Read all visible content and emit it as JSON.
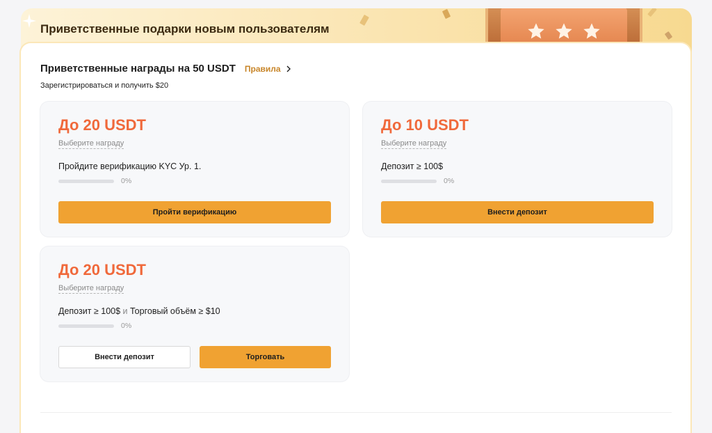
{
  "banner": {
    "title": "Приветственные подарки новым пользователям"
  },
  "section": {
    "title": "Приветственные награды на 50 USDT",
    "rules_label": "Правила",
    "subtitle": "Зарегистрироваться и получить $20"
  },
  "colors": {
    "accent": "#f0a232",
    "amount": "#f0693b",
    "link": "#c8862a"
  },
  "icons": {
    "rules": "chevron-right-icon",
    "banner": "gift-box-stars-icon"
  },
  "cards": [
    {
      "amount": "До 20 USDT",
      "choose_label": "Выберите награду",
      "task": "Пройдите верификацию KYC Ур. 1.",
      "progress_percent": 0,
      "progress_label": "0%",
      "button_label": "Пройти верификацию"
    },
    {
      "amount": "До 10 USDT",
      "choose_label": "Выберите награду",
      "task": "Депозит ≥ 100$",
      "progress_percent": 0,
      "progress_label": "0%",
      "button_label": "Внести депозит"
    },
    {
      "amount": "До 20 USDT",
      "choose_label": "Выберите награду",
      "task_part1": "Депозит ≥ 100$",
      "task_conj": "и",
      "task_part2": "Торговый объём ≥ $10",
      "progress_percent": 0,
      "progress_label": "0%",
      "secondary_button_label": "Внести депозит",
      "button_label": "Торговать"
    }
  ]
}
